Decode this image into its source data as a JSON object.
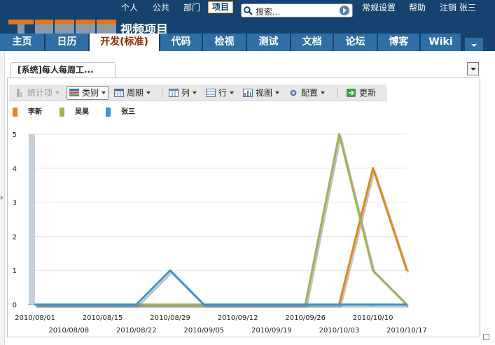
{
  "topnav": {
    "items": [
      "个人",
      "公共",
      "部门",
      "项目",
      "常规设置",
      "帮助",
      "注销 张三"
    ],
    "active": "项目",
    "search_placeholder": "搜索..."
  },
  "app": {
    "title": "视频项目"
  },
  "tabs": [
    "主页",
    "日历",
    "开发(标准)",
    "代码",
    "检视",
    "测试",
    "文档",
    "论坛",
    "博客",
    "Wiki"
  ],
  "active_tab": "开发(标准)",
  "widget": {
    "title": "[系统]每人每周工..."
  },
  "toolbar": {
    "stat_label": "统计项",
    "category_label": "类别",
    "week_label": "周期",
    "column_label": "列",
    "row_label": "行",
    "view_label": "视图",
    "config_label": "配置",
    "refresh_label": "更新"
  },
  "colors": {
    "header": "#15426e",
    "tab": "#2f6fa6",
    "active_tab_text": "#8a2a08"
  },
  "chart_data": {
    "type": "line",
    "x": [
      "2010/08/01",
      "2010/08/08",
      "2010/08/15",
      "2010/08/22",
      "2010/08/29",
      "2010/09/05",
      "2010/09/12",
      "2010/09/19",
      "2010/09/26",
      "2010/10/03",
      "2010/10/10",
      "2010/10/17"
    ],
    "x_labels_row1": [
      "2010/08/01",
      "2010/08/15",
      "2010/08/29",
      "2010/09/12",
      "2010/09/26",
      "2010/10/10"
    ],
    "x_labels_row2": [
      "2010/08/08",
      "2010/08/22",
      "2010/09/05",
      "2010/09/19",
      "2010/10/03",
      "2010/10/17"
    ],
    "y_ticks": [
      "0",
      "1",
      "2",
      "3",
      "4",
      "5"
    ],
    "ylim": [
      0,
      5
    ],
    "series": [
      {
        "name": "李新",
        "color": "#e08a1e",
        "values": [
          0,
          0,
          0,
          0,
          0,
          0,
          0,
          0,
          0,
          0,
          4,
          1
        ]
      },
      {
        "name": "吴昊",
        "color": "#9ab45a",
        "values": [
          0,
          0,
          0,
          0,
          0,
          0,
          0,
          0,
          0,
          5,
          1,
          0
        ]
      },
      {
        "name": "张三",
        "color": "#3a96d2",
        "values": [
          0,
          0,
          0,
          0,
          1,
          0,
          0,
          0,
          0,
          0,
          0,
          0
        ]
      }
    ],
    "legend": "top-left"
  }
}
